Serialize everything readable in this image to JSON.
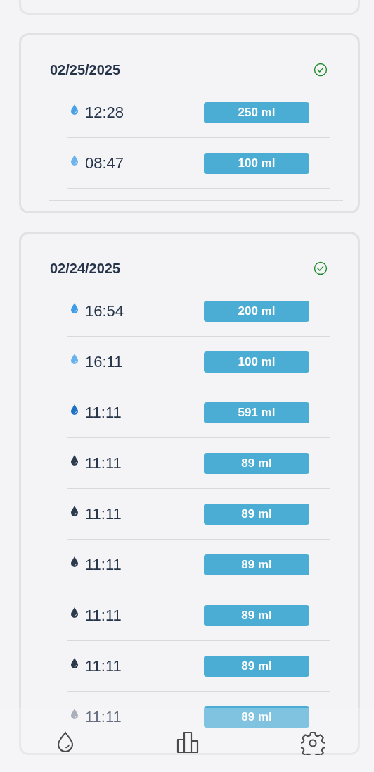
{
  "days": [
    {
      "date": "02/25/2025",
      "completed": true,
      "footer_rule": true,
      "entries": [
        {
          "time": "12:28",
          "amount": "250 ml",
          "color": "#4aa2e6"
        },
        {
          "time": "08:47",
          "amount": "100 ml",
          "color": "#6bb4ee"
        }
      ]
    },
    {
      "date": "02/24/2025",
      "completed": true,
      "footer_rule": false,
      "entries": [
        {
          "time": "16:54",
          "amount": "200 ml",
          "color": "#3f9ce8"
        },
        {
          "time": "16:11",
          "amount": "100 ml",
          "color": "#67b1ee"
        },
        {
          "time": "11:11",
          "amount": "591 ml",
          "color": "#1d72c6"
        },
        {
          "time": "11:11",
          "amount": "89 ml",
          "color": "#2c3a4e"
        },
        {
          "time": "11:11",
          "amount": "89 ml",
          "color": "#2c3a4e"
        },
        {
          "time": "11:11",
          "amount": "89 ml",
          "color": "#2c3a4e"
        },
        {
          "time": "11:11",
          "amount": "89 ml",
          "color": "#2c3a4e"
        },
        {
          "time": "11:11",
          "amount": "89 ml",
          "color": "#2c3a4e"
        },
        {
          "time": "11:11",
          "amount": "89 ml",
          "color": "#a9b0bb"
        }
      ]
    }
  ],
  "tab_bar": [
    {
      "kind": "log"
    },
    {
      "kind": "stats"
    },
    {
      "kind": "settings"
    }
  ]
}
